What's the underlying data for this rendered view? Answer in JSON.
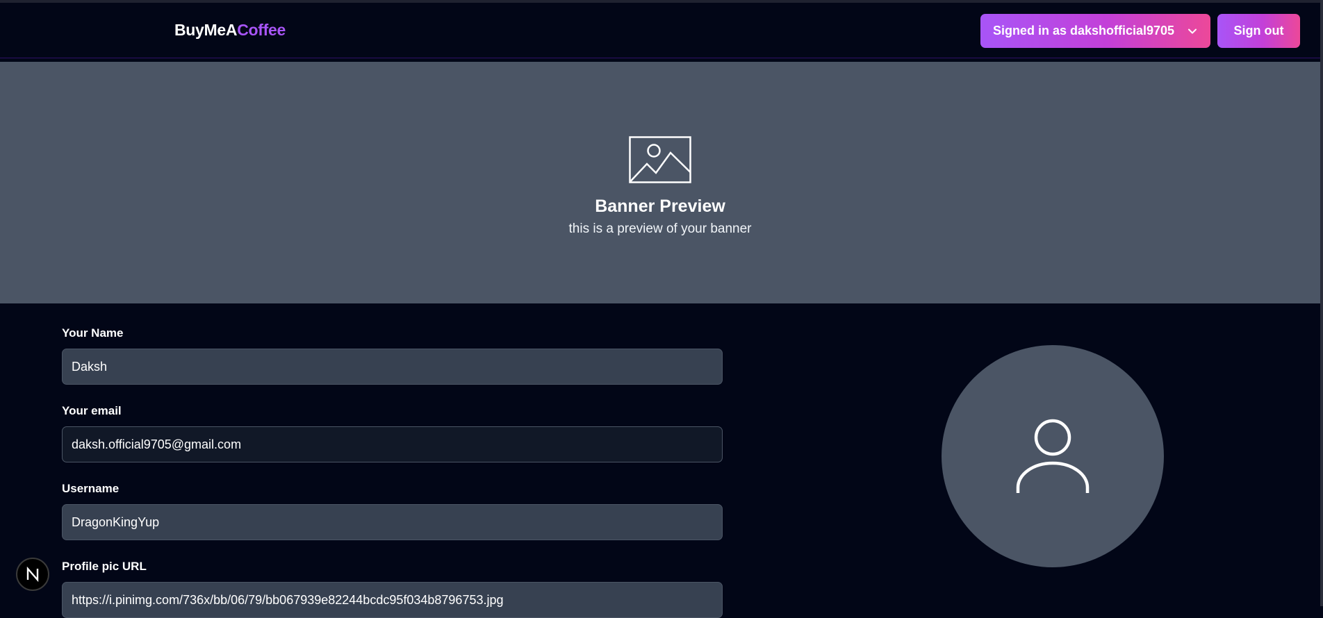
{
  "navbar": {
    "logo_part1": "BuyMeA",
    "logo_part2": "Coffee",
    "signed_in_label": "Signed in as dakshofficial9705",
    "sign_out_label": "Sign out"
  },
  "banner": {
    "icon": "image-icon",
    "title": "Banner Preview",
    "subtitle": "this is a preview of your banner"
  },
  "form": {
    "name_label": "Your Name",
    "name_value": "Daksh",
    "email_label": "Your email",
    "email_value": "daksh.official9705@gmail.com",
    "username_label": "Username",
    "username_value": "DragonKingYup",
    "profile_pic_label": "Profile pic URL",
    "profile_pic_value": "https://i.pinimg.com/736x/bb/06/79/bb067939e82244bcdc95f034b8796753.jpg"
  },
  "avatar": {
    "icon": "user-icon"
  },
  "dev_badge": {
    "label": "N"
  },
  "colors": {
    "background": "#020617",
    "banner": "#4b5565",
    "accent_purple": "#a855f7",
    "accent_pink": "#ec4899",
    "input_bg": "#374151",
    "input_bg_dark": "#111827"
  }
}
